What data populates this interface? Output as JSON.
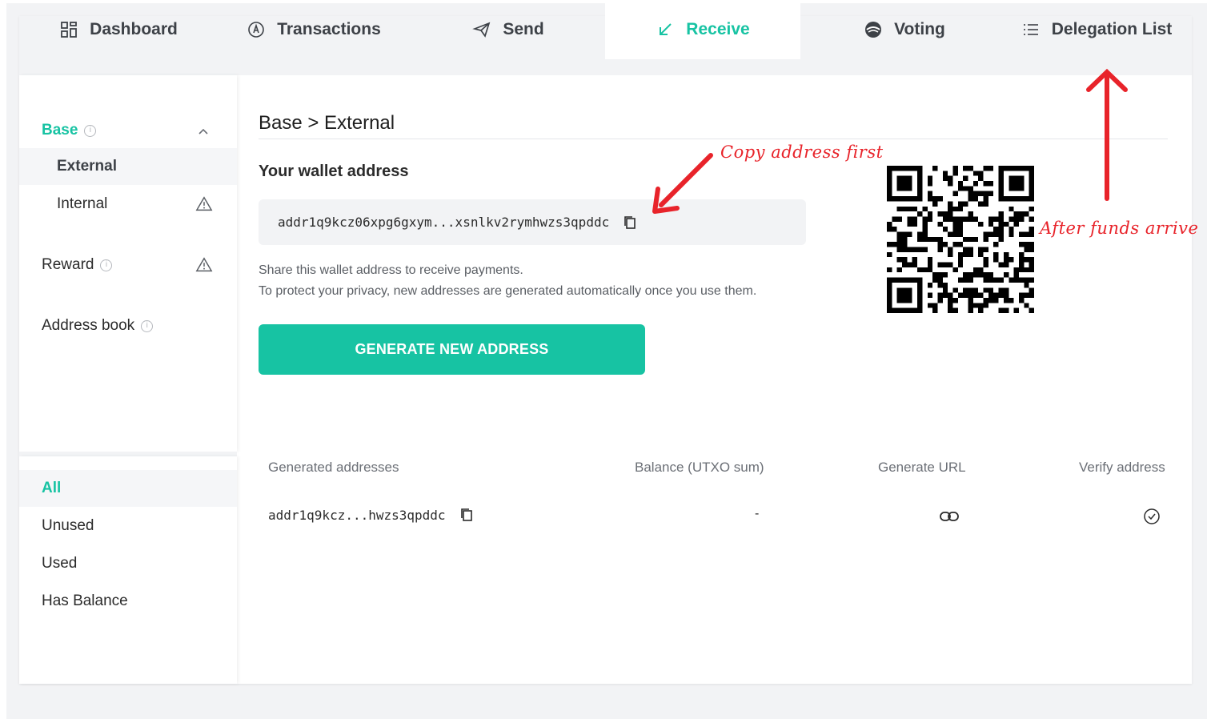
{
  "tabs": [
    {
      "label": "Dashboard",
      "icon": "dashboard-grid-icon"
    },
    {
      "label": "Transactions",
      "icon": "transactions-icon"
    },
    {
      "label": "Send",
      "icon": "send-plane-icon"
    },
    {
      "label": "Receive",
      "icon": "receive-arrow-icon",
      "active": true
    },
    {
      "label": "Voting",
      "icon": "voting-icon"
    },
    {
      "label": "Delegation List",
      "icon": "list-icon"
    }
  ],
  "sidebar": {
    "groups": [
      {
        "label": "Base",
        "expanded": true
      },
      {
        "label": "External"
      },
      {
        "label": "Internal"
      },
      {
        "label": "Reward"
      },
      {
        "label": "Address book"
      }
    ],
    "filters": [
      {
        "label": "All",
        "selected": true
      },
      {
        "label": "Unused"
      },
      {
        "label": "Used"
      },
      {
        "label": "Has Balance"
      }
    ]
  },
  "main": {
    "breadcrumb": "Base > External",
    "wallet_title": "Your wallet address",
    "address": "addr1q9kcz06xpg6gxym...xsnlkv2rymhwzs3qpddc",
    "note_1": "Share this wallet address to receive payments.",
    "note_2": "To protect your privacy, new addresses are generated automatically once you use them.",
    "generate_button": "GENERATE NEW ADDRESS"
  },
  "table": {
    "headers": [
      "Generated addresses",
      "Balance (UTXO sum)",
      "Generate URL",
      "Verify address"
    ],
    "rows": [
      {
        "address": "addr1q9kcz...hwzs3qpddc",
        "balance": "-"
      }
    ]
  },
  "annotations": {
    "copy_note": "Copy address first",
    "funds_note": "After funds arrive"
  },
  "colors": {
    "accent": "#17c3a3",
    "annotation": "#e8232a",
    "background": "#f2f3f5"
  }
}
